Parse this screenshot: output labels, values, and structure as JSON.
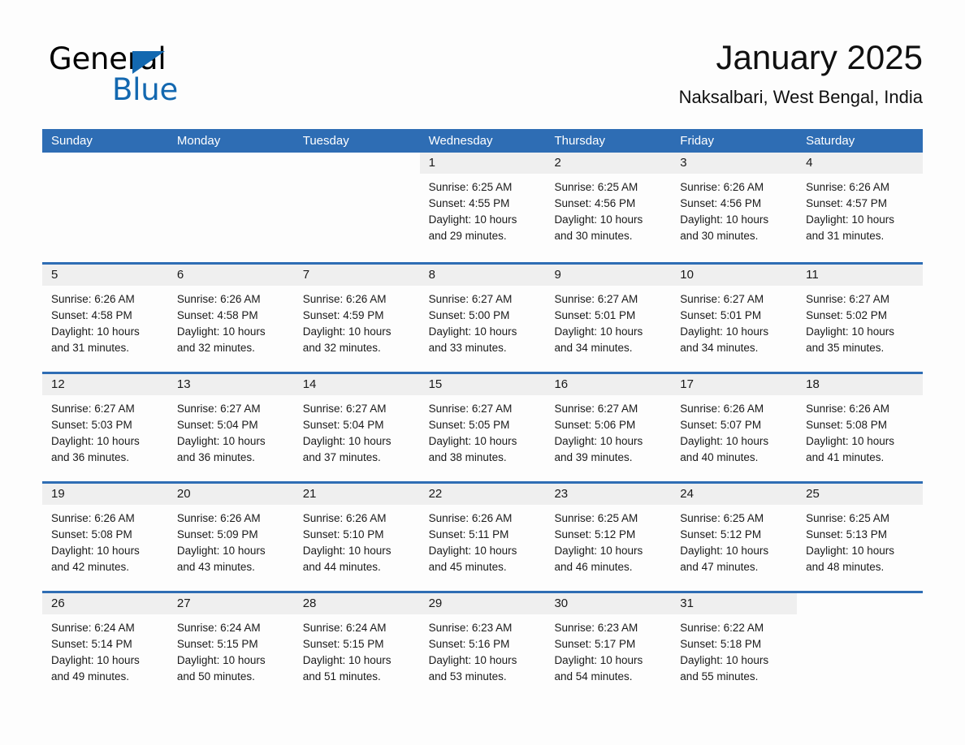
{
  "brand": {
    "name_part1": "General",
    "name_part2": "Blue",
    "accent_color": "#1368b0"
  },
  "header": {
    "title": "January 2025",
    "subtitle": "Naksalbari, West Bengal, India"
  },
  "theme": {
    "header_blue": "#2e6db4",
    "date_band_gray": "#efefef",
    "page_background": "#fdfdfd",
    "text_color": "#1a1a1a"
  },
  "weekdays": [
    "Sunday",
    "Monday",
    "Tuesday",
    "Wednesday",
    "Thursday",
    "Friday",
    "Saturday"
  ],
  "weeks": [
    [
      {
        "date": "",
        "sunrise": "",
        "sunset": "",
        "daylight_line1": "",
        "daylight_line2": "",
        "blank": true
      },
      {
        "date": "",
        "sunrise": "",
        "sunset": "",
        "daylight_line1": "",
        "daylight_line2": "",
        "blank": true
      },
      {
        "date": "",
        "sunrise": "",
        "sunset": "",
        "daylight_line1": "",
        "daylight_line2": "",
        "blank": true
      },
      {
        "date": "1",
        "sunrise": "Sunrise: 6:25 AM",
        "sunset": "Sunset: 4:55 PM",
        "daylight_line1": "Daylight: 10 hours",
        "daylight_line2": "and 29 minutes."
      },
      {
        "date": "2",
        "sunrise": "Sunrise: 6:25 AM",
        "sunset": "Sunset: 4:56 PM",
        "daylight_line1": "Daylight: 10 hours",
        "daylight_line2": "and 30 minutes."
      },
      {
        "date": "3",
        "sunrise": "Sunrise: 6:26 AM",
        "sunset": "Sunset: 4:56 PM",
        "daylight_line1": "Daylight: 10 hours",
        "daylight_line2": "and 30 minutes."
      },
      {
        "date": "4",
        "sunrise": "Sunrise: 6:26 AM",
        "sunset": "Sunset: 4:57 PM",
        "daylight_line1": "Daylight: 10 hours",
        "daylight_line2": "and 31 minutes."
      }
    ],
    [
      {
        "date": "5",
        "sunrise": "Sunrise: 6:26 AM",
        "sunset": "Sunset: 4:58 PM",
        "daylight_line1": "Daylight: 10 hours",
        "daylight_line2": "and 31 minutes."
      },
      {
        "date": "6",
        "sunrise": "Sunrise: 6:26 AM",
        "sunset": "Sunset: 4:58 PM",
        "daylight_line1": "Daylight: 10 hours",
        "daylight_line2": "and 32 minutes."
      },
      {
        "date": "7",
        "sunrise": "Sunrise: 6:26 AM",
        "sunset": "Sunset: 4:59 PM",
        "daylight_line1": "Daylight: 10 hours",
        "daylight_line2": "and 32 minutes."
      },
      {
        "date": "8",
        "sunrise": "Sunrise: 6:27 AM",
        "sunset": "Sunset: 5:00 PM",
        "daylight_line1": "Daylight: 10 hours",
        "daylight_line2": "and 33 minutes."
      },
      {
        "date": "9",
        "sunrise": "Sunrise: 6:27 AM",
        "sunset": "Sunset: 5:01 PM",
        "daylight_line1": "Daylight: 10 hours",
        "daylight_line2": "and 34 minutes."
      },
      {
        "date": "10",
        "sunrise": "Sunrise: 6:27 AM",
        "sunset": "Sunset: 5:01 PM",
        "daylight_line1": "Daylight: 10 hours",
        "daylight_line2": "and 34 minutes."
      },
      {
        "date": "11",
        "sunrise": "Sunrise: 6:27 AM",
        "sunset": "Sunset: 5:02 PM",
        "daylight_line1": "Daylight: 10 hours",
        "daylight_line2": "and 35 minutes."
      }
    ],
    [
      {
        "date": "12",
        "sunrise": "Sunrise: 6:27 AM",
        "sunset": "Sunset: 5:03 PM",
        "daylight_line1": "Daylight: 10 hours",
        "daylight_line2": "and 36 minutes."
      },
      {
        "date": "13",
        "sunrise": "Sunrise: 6:27 AM",
        "sunset": "Sunset: 5:04 PM",
        "daylight_line1": "Daylight: 10 hours",
        "daylight_line2": "and 36 minutes."
      },
      {
        "date": "14",
        "sunrise": "Sunrise: 6:27 AM",
        "sunset": "Sunset: 5:04 PM",
        "daylight_line1": "Daylight: 10 hours",
        "daylight_line2": "and 37 minutes."
      },
      {
        "date": "15",
        "sunrise": "Sunrise: 6:27 AM",
        "sunset": "Sunset: 5:05 PM",
        "daylight_line1": "Daylight: 10 hours",
        "daylight_line2": "and 38 minutes."
      },
      {
        "date": "16",
        "sunrise": "Sunrise: 6:27 AM",
        "sunset": "Sunset: 5:06 PM",
        "daylight_line1": "Daylight: 10 hours",
        "daylight_line2": "and 39 minutes."
      },
      {
        "date": "17",
        "sunrise": "Sunrise: 6:26 AM",
        "sunset": "Sunset: 5:07 PM",
        "daylight_line1": "Daylight: 10 hours",
        "daylight_line2": "and 40 minutes."
      },
      {
        "date": "18",
        "sunrise": "Sunrise: 6:26 AM",
        "sunset": "Sunset: 5:08 PM",
        "daylight_line1": "Daylight: 10 hours",
        "daylight_line2": "and 41 minutes."
      }
    ],
    [
      {
        "date": "19",
        "sunrise": "Sunrise: 6:26 AM",
        "sunset": "Sunset: 5:08 PM",
        "daylight_line1": "Daylight: 10 hours",
        "daylight_line2": "and 42 minutes."
      },
      {
        "date": "20",
        "sunrise": "Sunrise: 6:26 AM",
        "sunset": "Sunset: 5:09 PM",
        "daylight_line1": "Daylight: 10 hours",
        "daylight_line2": "and 43 minutes."
      },
      {
        "date": "21",
        "sunrise": "Sunrise: 6:26 AM",
        "sunset": "Sunset: 5:10 PM",
        "daylight_line1": "Daylight: 10 hours",
        "daylight_line2": "and 44 minutes."
      },
      {
        "date": "22",
        "sunrise": "Sunrise: 6:26 AM",
        "sunset": "Sunset: 5:11 PM",
        "daylight_line1": "Daylight: 10 hours",
        "daylight_line2": "and 45 minutes."
      },
      {
        "date": "23",
        "sunrise": "Sunrise: 6:25 AM",
        "sunset": "Sunset: 5:12 PM",
        "daylight_line1": "Daylight: 10 hours",
        "daylight_line2": "and 46 minutes."
      },
      {
        "date": "24",
        "sunrise": "Sunrise: 6:25 AM",
        "sunset": "Sunset: 5:12 PM",
        "daylight_line1": "Daylight: 10 hours",
        "daylight_line2": "and 47 minutes."
      },
      {
        "date": "25",
        "sunrise": "Sunrise: 6:25 AM",
        "sunset": "Sunset: 5:13 PM",
        "daylight_line1": "Daylight: 10 hours",
        "daylight_line2": "and 48 minutes."
      }
    ],
    [
      {
        "date": "26",
        "sunrise": "Sunrise: 6:24 AM",
        "sunset": "Sunset: 5:14 PM",
        "daylight_line1": "Daylight: 10 hours",
        "daylight_line2": "and 49 minutes."
      },
      {
        "date": "27",
        "sunrise": "Sunrise: 6:24 AM",
        "sunset": "Sunset: 5:15 PM",
        "daylight_line1": "Daylight: 10 hours",
        "daylight_line2": "and 50 minutes."
      },
      {
        "date": "28",
        "sunrise": "Sunrise: 6:24 AM",
        "sunset": "Sunset: 5:15 PM",
        "daylight_line1": "Daylight: 10 hours",
        "daylight_line2": "and 51 minutes."
      },
      {
        "date": "29",
        "sunrise": "Sunrise: 6:23 AM",
        "sunset": "Sunset: 5:16 PM",
        "daylight_line1": "Daylight: 10 hours",
        "daylight_line2": "and 53 minutes."
      },
      {
        "date": "30",
        "sunrise": "Sunrise: 6:23 AM",
        "sunset": "Sunset: 5:17 PM",
        "daylight_line1": "Daylight: 10 hours",
        "daylight_line2": "and 54 minutes."
      },
      {
        "date": "31",
        "sunrise": "Sunrise: 6:22 AM",
        "sunset": "Sunset: 5:18 PM",
        "daylight_line1": "Daylight: 10 hours",
        "daylight_line2": "and 55 minutes."
      },
      {
        "date": "",
        "sunrise": "",
        "sunset": "",
        "daylight_line1": "",
        "daylight_line2": "",
        "blank": true
      }
    ]
  ]
}
